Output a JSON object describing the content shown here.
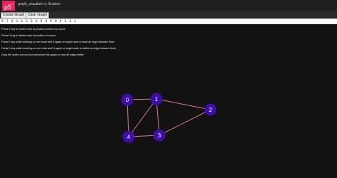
{
  "header": {
    "logo": "p5",
    "logo_sup": "*",
    "sketch_name": "graph_visualize",
    "by_label": "by",
    "author": "Snakee"
  },
  "buttons": {
    "create": "Create Graph",
    "clear": "Clear Graph"
  },
  "sequence_input": {
    "value": "5 7 0 1 1 2 2 3 3 4 4 0 4 1 3 1"
  },
  "instructions": [
    "Press V key to create node at position pointed by mouse",
    "Press D key to delete node at position of mouse",
    "Press E key while hovering on one node and E again on target node to draw an edge between them",
    "Press D key while hovering on one node and D again on target node to delete an edge between them",
    "Drag the nodes around and restructure the graph to view all edges better"
  ],
  "graph": {
    "node_color": "#3d0ea8",
    "edge_color": "#e07a8a",
    "nodes": [
      {
        "label": "0"
      },
      {
        "label": "1"
      },
      {
        "label": "2"
      },
      {
        "label": "3"
      },
      {
        "label": "4"
      }
    ],
    "edges": [
      [
        0,
        1
      ],
      [
        1,
        2
      ],
      [
        2,
        3
      ],
      [
        3,
        4
      ],
      [
        4,
        0
      ],
      [
        4,
        1
      ],
      [
        3,
        1
      ]
    ]
  }
}
